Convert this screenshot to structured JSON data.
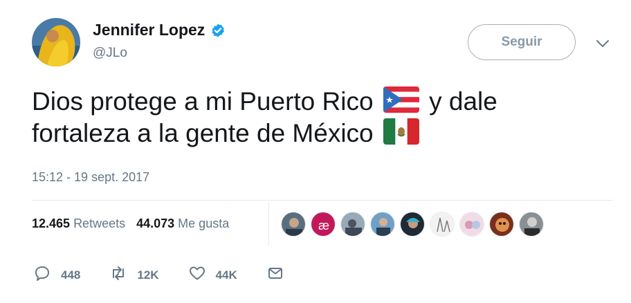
{
  "user": {
    "name": "Jennifer Lopez",
    "handle": "@JLo"
  },
  "follow_button": "Seguir",
  "tweet": {
    "text_part1": "Dios protege a mi Puerto Rico",
    "text_part2": "y dale fortaleza a la gente de México",
    "timestamp": "15:12 - 19 sept. 2017"
  },
  "stats": {
    "retweets_count": "12.465",
    "retweets_label": "Retweets",
    "likes_count": "44.073",
    "likes_label": "Me gusta"
  },
  "likers_count": 9,
  "actions": {
    "reply_count": "448",
    "retweet_count": "12K",
    "like_count": "44K"
  },
  "colors": {
    "accent": "#1da1f2",
    "muted": "#657786",
    "text": "#14171a"
  }
}
